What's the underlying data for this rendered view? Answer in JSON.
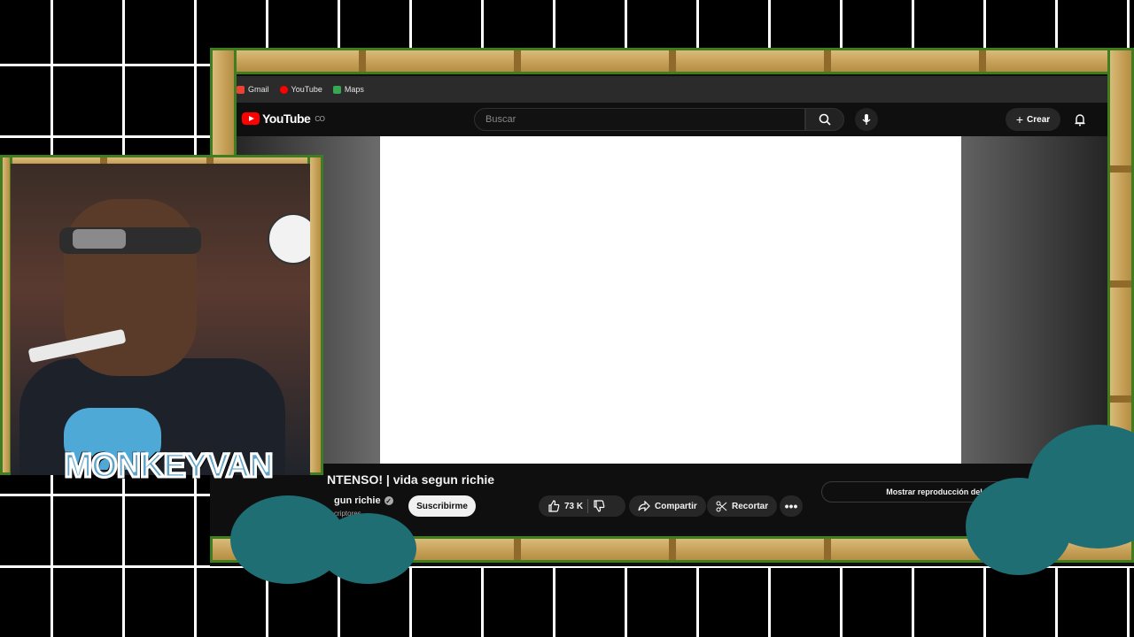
{
  "bookmarks": [
    {
      "label": "Gmail"
    },
    {
      "label": "YouTube"
    },
    {
      "label": "Maps"
    }
  ],
  "youtube": {
    "logo_text": "YouTube",
    "logo_sup": "CO",
    "search_placeholder": "Buscar",
    "create_label": "Crear"
  },
  "video": {
    "title": "NTENSO! | vida segun richie",
    "channel": "gun richie",
    "subscribers": "criptores",
    "subscribe_label": "Suscribirme",
    "likes": "73 K",
    "share_label": "Compartir",
    "clip_label": "Recortar",
    "chat_replay_label": "Mostrar reproducción del chat"
  },
  "overlay": {
    "brand_text": "MONKEYVAN"
  },
  "colors": {
    "accent": "#ff0000",
    "frame_green": "#3f7d20",
    "frame_bamboo": "#c9a35b",
    "bush": "#1e6e74"
  }
}
